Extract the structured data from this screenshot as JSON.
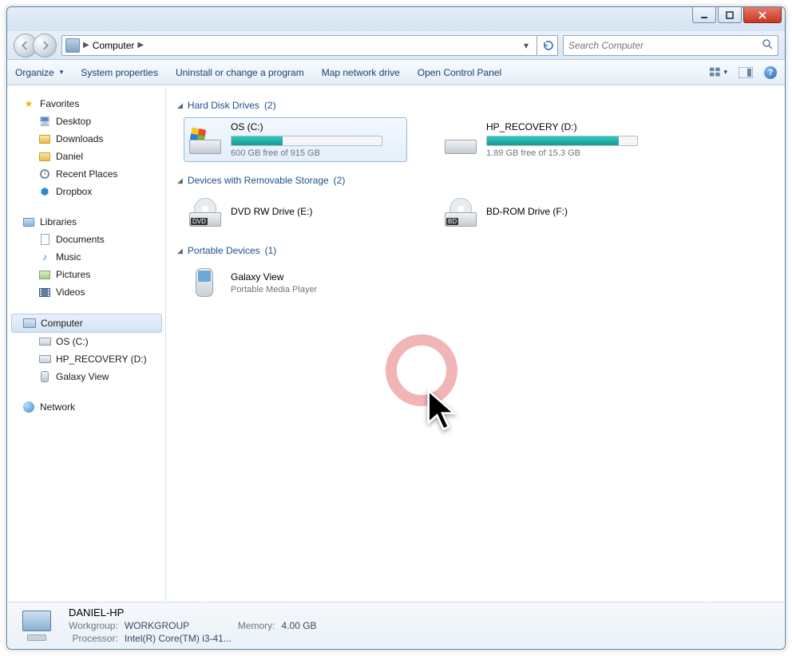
{
  "titlebar": {
    "min": "–",
    "max": "▢",
    "close": "✕"
  },
  "address": {
    "location": "Computer"
  },
  "search": {
    "placeholder": "Search Computer"
  },
  "toolbar": {
    "organize": "Organize",
    "sysprops": "System properties",
    "uninstall": "Uninstall or change a program",
    "mapdrive": "Map network drive",
    "controlpanel": "Open Control Panel"
  },
  "sidebar": {
    "favorites": {
      "label": "Favorites",
      "items": [
        "Desktop",
        "Downloads",
        "Daniel",
        "Recent Places",
        "Dropbox"
      ]
    },
    "libraries": {
      "label": "Libraries",
      "items": [
        "Documents",
        "Music",
        "Pictures",
        "Videos"
      ]
    },
    "computer": {
      "label": "Computer",
      "items": [
        "OS (C:)",
        "HP_RECOVERY (D:)",
        "Galaxy View"
      ]
    },
    "network": {
      "label": "Network"
    }
  },
  "sections": {
    "hdd": {
      "title": "Hard Disk Drives",
      "count": "(2)",
      "drives": [
        {
          "name": "OS (C:)",
          "free": "600 GB free of 915 GB",
          "pct": 34
        },
        {
          "name": "HP_RECOVERY (D:)",
          "free": "1.89 GB free of 15.3 GB",
          "pct": 88
        }
      ]
    },
    "removable": {
      "title": "Devices with Removable Storage",
      "count": "(2)",
      "drives": [
        {
          "name": "DVD RW Drive (E:)",
          "badge": "DVD"
        },
        {
          "name": "BD-ROM Drive (F:)",
          "badge": "BD"
        }
      ]
    },
    "portable": {
      "title": "Portable Devices",
      "count": "(1)",
      "drives": [
        {
          "name": "Galaxy View",
          "sub": "Portable Media Player"
        }
      ]
    }
  },
  "details": {
    "name": "DANIEL-HP",
    "workgroup_lbl": "Workgroup:",
    "workgroup": "WORKGROUP",
    "memory_lbl": "Memory:",
    "memory": "4.00 GB",
    "processor_lbl": "Processor:",
    "processor": "Intel(R) Core(TM) i3-41..."
  }
}
